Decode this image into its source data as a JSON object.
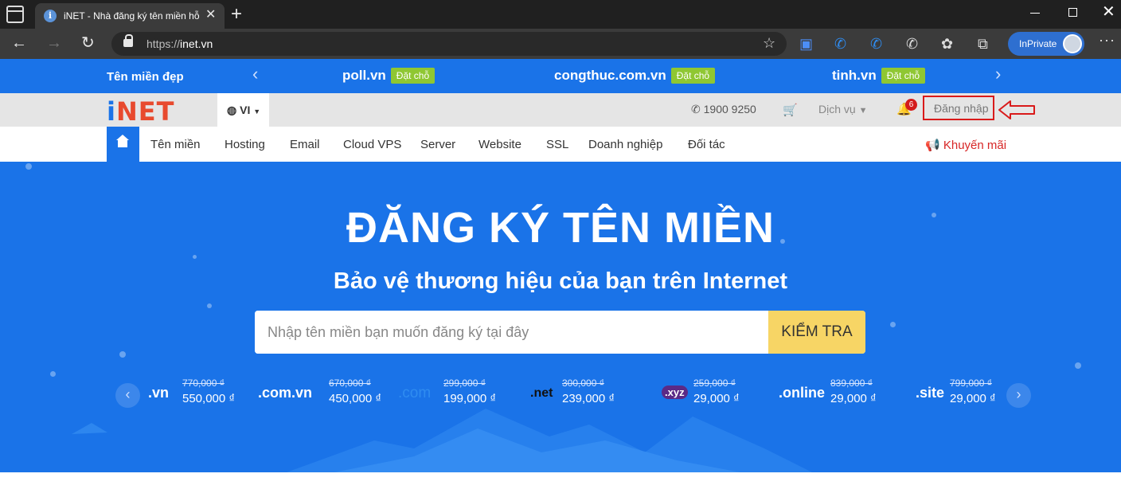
{
  "browser": {
    "tab_title": "iNET - Nhà đăng ký tên miền hỗ",
    "url_prefix": "https://",
    "url_host": "inet.vn",
    "inprivate_label": "InPrivate"
  },
  "promo_bar": {
    "title": "Tên miền đẹp",
    "items": [
      {
        "domain": "poll.vn",
        "button": "Đặt chỗ"
      },
      {
        "domain": "congthuc.com.vn",
        "button": "Đặt chỗ"
      },
      {
        "domain": "tinh.vn",
        "button": "Đặt chỗ"
      }
    ]
  },
  "header": {
    "logo_i": "i",
    "logo_rest": "NET",
    "language": "VI",
    "phone": "1900 9250",
    "service_label": "Dịch vụ",
    "notification_count": "6",
    "login_label": "Đăng nhập"
  },
  "nav": {
    "items": [
      "Tên miền",
      "Hosting",
      "Email",
      "Cloud VPS",
      "Server",
      "Website",
      "SSL",
      "Doanh nghiệp",
      "Đối tác"
    ],
    "promo_label": "Khuyến mãi"
  },
  "hero": {
    "title": "ĐĂNG KÝ TÊN MIỀN",
    "subtitle": "Bảo vệ thương hiệu của bạn trên Internet",
    "search_placeholder": "Nhập tên miền bạn muốn đăng ký tại đây",
    "search_button": "KIỂM TRA"
  },
  "tlds": [
    {
      "name": ".vn",
      "old_price": "770,000 ₫",
      "new_price": "550,000 ₫"
    },
    {
      "name": ".com.vn",
      "old_price": "670,000 ₫",
      "new_price": "450,000 ₫"
    },
    {
      "name": ".com",
      "old_price": "299,000 ₫",
      "new_price": "199,000 ₫"
    },
    {
      "name": ".net",
      "old_price": "300,000 ₫",
      "new_price": "239,000 ₫"
    },
    {
      "name": ".xyz",
      "old_price": "259,000 ₫",
      "new_price": "29,000 ₫"
    },
    {
      "name": ".online",
      "old_price": "839,000 ₫",
      "new_price": "29,000 ₫"
    },
    {
      "name": ".site",
      "old_price": "799,000 ₫",
      "new_price": "29,000 ₫"
    }
  ],
  "colors": {
    "brand_blue": "#1a73e8",
    "logo_red": "#e84a2e",
    "reserve_green": "#8fc732",
    "check_yellow": "#f7d565",
    "highlight_red": "#d91a1a"
  }
}
